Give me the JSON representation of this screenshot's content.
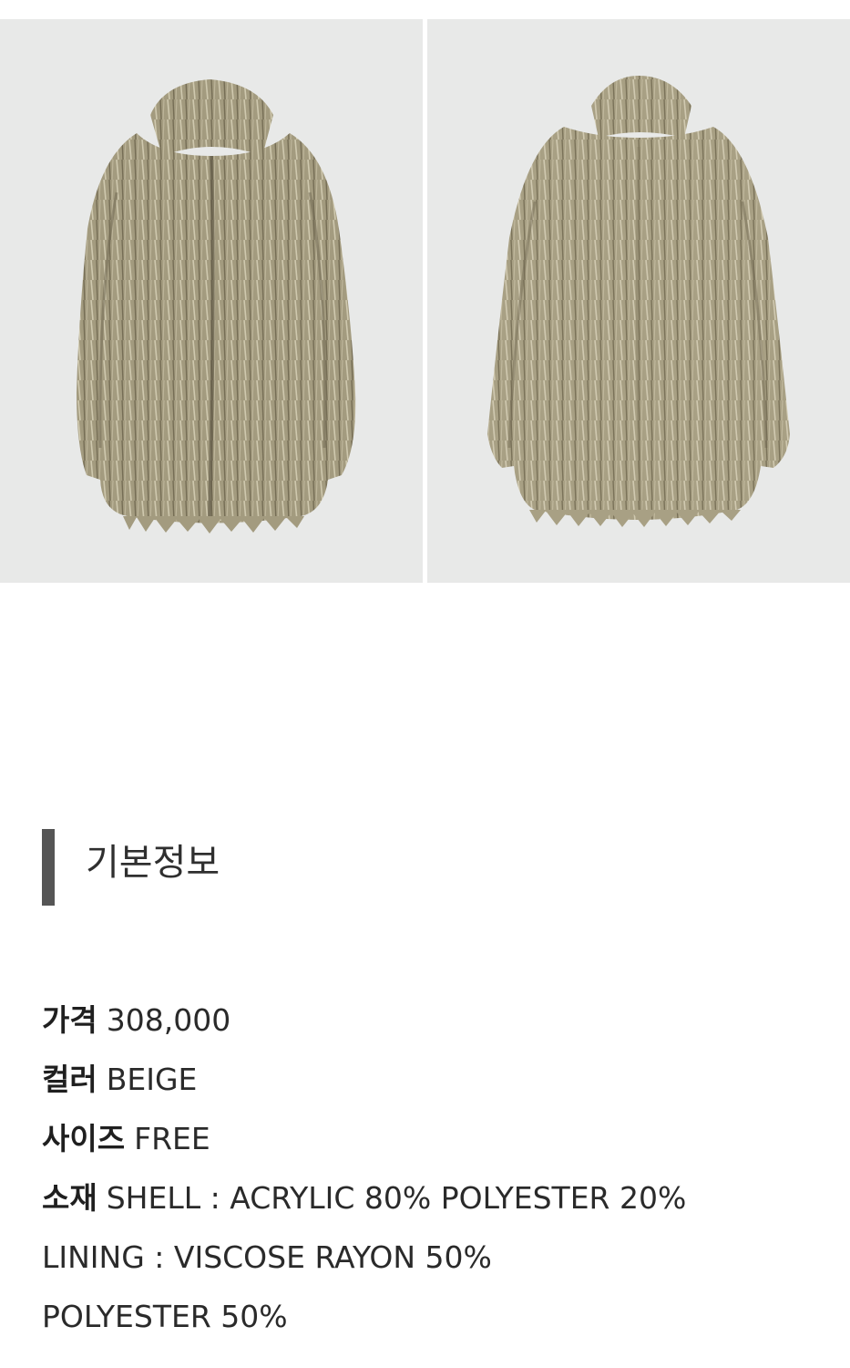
{
  "images": [
    {
      "name": "coat-front-photo",
      "icon": "faux-fur-coat-front"
    },
    {
      "name": "coat-back-photo",
      "icon": "faux-fur-coat-back"
    }
  ],
  "section": {
    "title": "기본정보"
  },
  "info": {
    "price": {
      "label": "가격",
      "value": "308,000"
    },
    "color": {
      "label": "컬러",
      "value": "BEIGE"
    },
    "size": {
      "label": "사이즈",
      "value": "FREE"
    },
    "material": {
      "label": "소재",
      "shell": "SHELL : ACRYLIC 80% POLYESTER 20%",
      "lining": "LINING : VISCOSE RAYON 50%",
      "lining_cont": "POLYESTER 50%"
    }
  },
  "colors": {
    "photo_background": "#e8e9e8",
    "fur_base": "#9c9478",
    "fur_light": "#c9c2a8",
    "fur_dark": "#6e664f",
    "section_bar": "#555555"
  }
}
